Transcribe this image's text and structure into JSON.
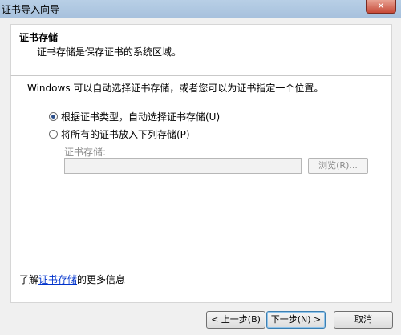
{
  "window": {
    "title": "证书导入向导",
    "close_label": "✕"
  },
  "header": {
    "title": "证书存储",
    "description": "证书存储是保存证书的系统区域。"
  },
  "body": {
    "instruction": "Windows 可以自动选择证书存储，或者您可以为证书指定一个位置。",
    "options": [
      {
        "label": "根据证书类型，自动选择证书存储(U)",
        "checked": true
      },
      {
        "label": "将所有的证书放入下列存储(P)",
        "checked": false
      }
    ],
    "store_label": "证书存储:",
    "store_value": "",
    "browse_label": "浏览(R)...",
    "learn_more_prefix": "了解",
    "learn_more_link": "证书存储",
    "learn_more_suffix": "的更多信息"
  },
  "footer": {
    "back_label": "< 上一步(B)",
    "next_label": "下一步(N) >",
    "cancel_label": "取消"
  }
}
